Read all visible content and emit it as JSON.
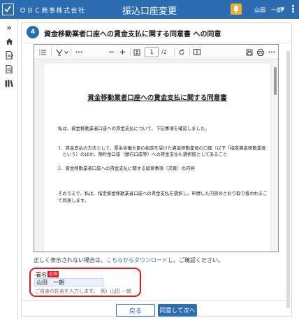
{
  "header": {
    "company": "ＯＢＣ商事株式会社",
    "title": "振込口座変更",
    "user_name": "山田　一朗",
    "user_caret": "▼"
  },
  "sidebar": {
    "expand_label": "»",
    "items": [
      {
        "icon": "home-icon"
      },
      {
        "icon": "document-edit-icon"
      },
      {
        "icon": "document-search-icon"
      },
      {
        "icon": "books-icon"
      }
    ]
  },
  "step": {
    "number": "4",
    "title": "資金移動業者口座への賃金支払に関する同意書 への同意"
  },
  "pdf": {
    "page_current": "1",
    "page_total": "/2",
    "doc_title": "資金移動業者口座への賃金支払に関する同意書",
    "paragraphs": [
      "私は、資金移動業者口座への賃金支払について、下記事項を確認しました。",
      "1．賃金支払の方法として、厚生労働大臣の指定を受けた資金移動業者の口座（以下「指定資金移動業者",
      "　という）のほか、預貯金口座（銀行口座等）への賃金支払も選択肢としてあること",
      "2．資金移動業者口座への賃金支払に関する留意事項（次頁）の内容",
      "そのうえで、私は、指定資金移動業者口座への賃金支払を選択し、申請した内容のとおり取り扱われるこ",
      "て同意します。"
    ]
  },
  "help": {
    "prefix": "正しく表示されない場合は、",
    "link": "こちらからダウンロード",
    "suffix": "し、ご確認ください。"
  },
  "signature": {
    "label": "署名",
    "required": "必須",
    "value": "山田　一朗",
    "hint": "ご自身の氏名を入力します。　例）山田 一朗"
  },
  "footer": {
    "back_label": "戻る",
    "next_label": "同意して次へ"
  },
  "colors": {
    "brand": "#2c6cb0",
    "highlight": "#e0181f",
    "notification": "#f0ad2f"
  }
}
